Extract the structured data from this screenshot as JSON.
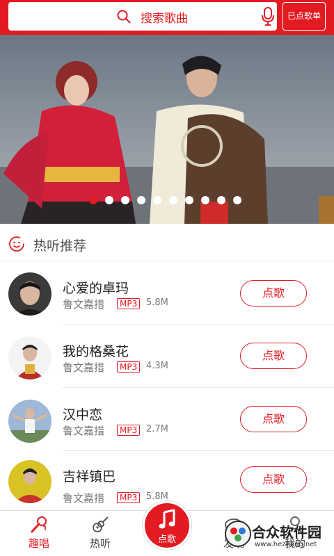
{
  "search": {
    "placeholder": "搜索歌曲"
  },
  "queue_button": {
    "label": "已点歌单"
  },
  "banner": {
    "slide_count": 10,
    "active_index": 0
  },
  "section": {
    "title": "热听推荐"
  },
  "songs": [
    {
      "title": "心爱的卓玛",
      "artist": "鲁文嘉措",
      "format": "MP3",
      "size": "5.8M",
      "action": "点歌"
    },
    {
      "title": "我的格桑花",
      "artist": "鲁文嘉措",
      "format": "MP3",
      "size": "4.3M",
      "action": "点歌"
    },
    {
      "title": "汉中恋",
      "artist": "鲁文嘉措",
      "format": "MP3",
      "size": "2.7M",
      "action": "点歌"
    },
    {
      "title": "吉祥镇巴",
      "artist": "鲁文嘉措",
      "format": "MP3",
      "size": "5.8M",
      "action": "点歌"
    }
  ],
  "nav": {
    "tabs": [
      {
        "label": "趣唱",
        "icon": "microphone-icon",
        "active": true
      },
      {
        "label": "热听",
        "icon": "guitar-icon",
        "active": false
      },
      {
        "label": "点歌",
        "icon": "music-note-icon",
        "active": false
      },
      {
        "label": "发现",
        "icon": "discover-icon",
        "active": false
      },
      {
        "label": "我的",
        "icon": "user-icon",
        "active": false
      }
    ]
  },
  "watermark": {
    "text": "合众软件园",
    "url": "www.hezhong.net"
  },
  "colors": {
    "accent": "#e21b23"
  }
}
